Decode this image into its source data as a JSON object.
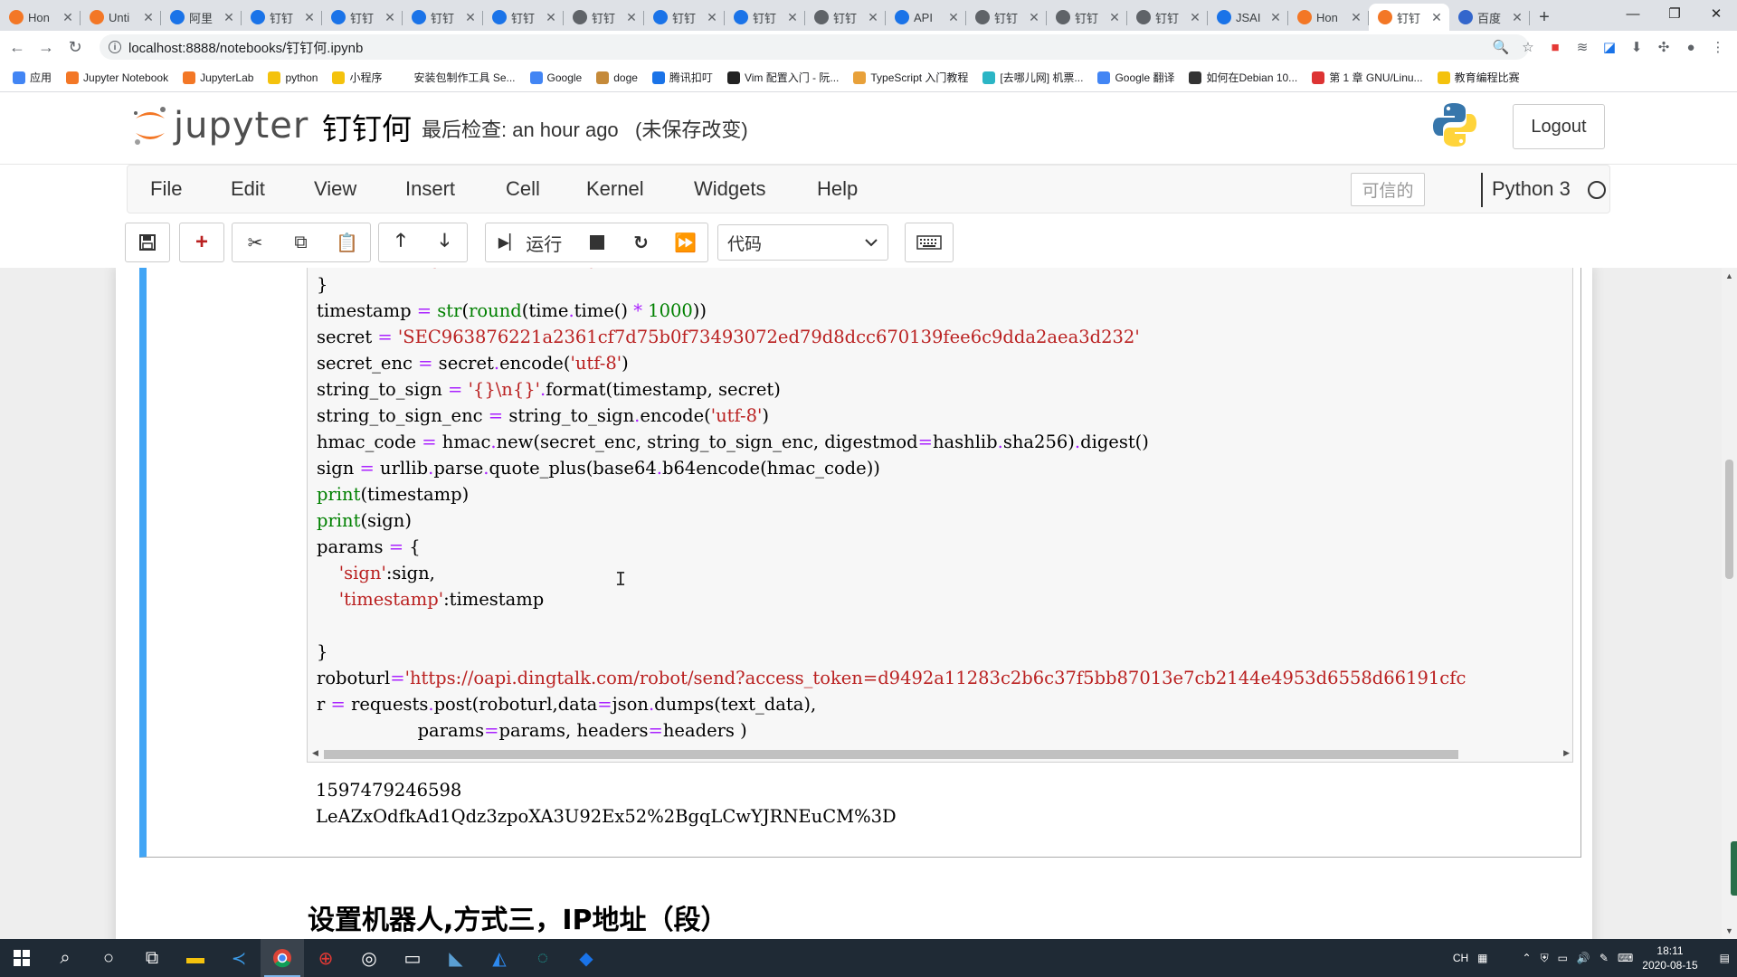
{
  "browser": {
    "tabs": [
      {
        "title": "Hon",
        "color": "#f37726"
      },
      {
        "title": "Unti",
        "color": "#f37726"
      },
      {
        "title": "阿里",
        "color": "#1a73e8"
      },
      {
        "title": "钉钉",
        "color": "#1a73e8"
      },
      {
        "title": "钉钉",
        "color": "#1a73e8"
      },
      {
        "title": "钉钉",
        "color": "#1a73e8"
      },
      {
        "title": "钉钉",
        "color": "#1a73e8"
      },
      {
        "title": "钉钉",
        "color": "#5f6368"
      },
      {
        "title": "钉钉",
        "color": "#1a73e8"
      },
      {
        "title": "钉钉",
        "color": "#1a73e8"
      },
      {
        "title": "钉钉",
        "color": "#5f6368"
      },
      {
        "title": "API",
        "color": "#1a73e8"
      },
      {
        "title": "钉钉",
        "color": "#5f6368"
      },
      {
        "title": "钉钉",
        "color": "#5f6368"
      },
      {
        "title": "钉钉",
        "color": "#5f6368"
      },
      {
        "title": "JSAI",
        "color": "#1a73e8"
      },
      {
        "title": "Hon",
        "color": "#f37726"
      },
      {
        "title": "钉钉",
        "color": "#f37726",
        "active": true
      },
      {
        "title": "百度",
        "color": "#3366cc"
      }
    ],
    "url": "localhost:8888/notebooks/钉钉何.ipynb",
    "bookmarks": [
      {
        "label": "应用",
        "color": "#4285f4"
      },
      {
        "label": "Jupyter Notebook",
        "color": "#f37726"
      },
      {
        "label": "JupyterLab",
        "color": "#f37726"
      },
      {
        "label": "python",
        "color": "#f4c20d"
      },
      {
        "label": "小程序",
        "color": "#f4c20d"
      },
      {
        "label": "安装包制作工具 Se...",
        "color": "#ffffff"
      },
      {
        "label": "Google",
        "color": "#4285f4"
      },
      {
        "label": "doge",
        "color": "#c58a3a"
      },
      {
        "label": "腾讯扣叮",
        "color": "#1a73e8"
      },
      {
        "label": "Vim 配置入门 - 阮...",
        "color": "#222222"
      },
      {
        "label": "TypeScript 入门教程",
        "color": "#e8a13a"
      },
      {
        "label": "[去哪儿网] 机票...",
        "color": "#2bb5c5"
      },
      {
        "label": "Google 翻译",
        "color": "#4285f4"
      },
      {
        "label": "如何在Debian 10...",
        "color": "#333333"
      },
      {
        "label": "第 1 章 GNU/Linu...",
        "color": "#d33"
      },
      {
        "label": "教育编程比赛",
        "color": "#f4c20d"
      }
    ]
  },
  "jupyter": {
    "logo_text": "jupyter",
    "notebook_name": "钉钉何",
    "checkpoint": "最后检查: an hour ago",
    "autosave": "(未保存改变)",
    "logout": "Logout",
    "menu": [
      "File",
      "Edit",
      "View",
      "Insert",
      "Cell",
      "Kernel",
      "Widgets",
      "Help"
    ],
    "trusted": "可信的",
    "kernel": "Python 3",
    "run_label": "运行",
    "cell_type": "代码"
  },
  "cell": {
    "code_html_note": "lines rendered with syntax spans",
    "lines": [
      [
        [
          "    ",
          "p"
        ],
        [
          "'Content-Type'",
          "s"
        ],
        [
          ": ",
          "p"
        ],
        [
          "'application/json'",
          "s"
        ],
        [
          ",",
          "p"
        ]
      ],
      [
        [
          "}",
          "p"
        ]
      ],
      [
        [
          "timestamp ",
          "p"
        ],
        [
          "=",
          "o"
        ],
        [
          " ",
          "p"
        ],
        [
          "str",
          "b"
        ],
        [
          "(",
          "p"
        ],
        [
          "round",
          "b"
        ],
        [
          "(time",
          "p"
        ],
        [
          ".",
          "o"
        ],
        [
          "time() ",
          "p"
        ],
        [
          "*",
          "o"
        ],
        [
          " ",
          "p"
        ],
        [
          "1000",
          "b"
        ],
        [
          "))",
          "p"
        ]
      ],
      [
        [
          "secret ",
          "p"
        ],
        [
          "=",
          "o"
        ],
        [
          " ",
          "p"
        ],
        [
          "'SEC963876221a2361cf7d75b0f73493072ed79d8dcc670139fee6c9dda2aea3d232'",
          "s"
        ]
      ],
      [
        [
          "secret_enc ",
          "p"
        ],
        [
          "=",
          "o"
        ],
        [
          " secret",
          "p"
        ],
        [
          ".",
          "o"
        ],
        [
          "encode(",
          "p"
        ],
        [
          "'utf-8'",
          "s"
        ],
        [
          ")",
          "p"
        ]
      ],
      [
        [
          "string_to_sign ",
          "p"
        ],
        [
          "=",
          "o"
        ],
        [
          " ",
          "p"
        ],
        [
          "'{}\\n{}'",
          "s"
        ],
        [
          ".",
          "o"
        ],
        [
          "format(timestamp, secret)",
          "p"
        ]
      ],
      [
        [
          "string_to_sign_enc ",
          "p"
        ],
        [
          "=",
          "o"
        ],
        [
          " string_to_sign",
          "p"
        ],
        [
          ".",
          "o"
        ],
        [
          "encode(",
          "p"
        ],
        [
          "'utf-8'",
          "s"
        ],
        [
          ")",
          "p"
        ]
      ],
      [
        [
          "hmac_code ",
          "p"
        ],
        [
          "=",
          "o"
        ],
        [
          " hmac",
          "p"
        ],
        [
          ".",
          "o"
        ],
        [
          "new(secret_enc, string_to_sign_enc, digestmod",
          "p"
        ],
        [
          "=",
          "o"
        ],
        [
          "hashlib",
          "p"
        ],
        [
          ".",
          "o"
        ],
        [
          "sha256)",
          "p"
        ],
        [
          ".",
          "o"
        ],
        [
          "digest()",
          "p"
        ]
      ],
      [
        [
          "sign ",
          "p"
        ],
        [
          "=",
          "o"
        ],
        [
          " urllib",
          "p"
        ],
        [
          ".",
          "o"
        ],
        [
          "parse",
          "p"
        ],
        [
          ".",
          "o"
        ],
        [
          "quote_plus(base64",
          "p"
        ],
        [
          ".",
          "o"
        ],
        [
          "b64encode(hmac_code))",
          "p"
        ]
      ],
      [
        [
          "print",
          "b"
        ],
        [
          "(timestamp)",
          "p"
        ]
      ],
      [
        [
          "print",
          "b"
        ],
        [
          "(sign)",
          "p"
        ]
      ],
      [
        [
          "params ",
          "p"
        ],
        [
          "=",
          "o"
        ],
        [
          " {",
          "p"
        ]
      ],
      [
        [
          "    ",
          "p"
        ],
        [
          "'sign'",
          "s"
        ],
        [
          ":sign,",
          "p"
        ]
      ],
      [
        [
          "    ",
          "p"
        ],
        [
          "'timestamp'",
          "s"
        ],
        [
          ":timestamp",
          "p"
        ]
      ],
      [
        [
          "",
          "p"
        ]
      ],
      [
        [
          "}",
          "p"
        ]
      ],
      [
        [
          "roboturl",
          "p"
        ],
        [
          "=",
          "o"
        ],
        [
          "'https://oapi.dingtalk.com/robot/send?access_token=d9492a11283c2b6c37f5bb87013e7cb2144e4953d6558d66191cfc",
          "s"
        ]
      ],
      [
        [
          "r ",
          "p"
        ],
        [
          "=",
          "o"
        ],
        [
          " requests",
          "p"
        ],
        [
          ".",
          "o"
        ],
        [
          "post(roboturl,data",
          "p"
        ],
        [
          "=",
          "o"
        ],
        [
          "json",
          "p"
        ],
        [
          ".",
          "o"
        ],
        [
          "dumps(text_data),",
          "p"
        ]
      ],
      [
        [
          "                  params",
          "p"
        ],
        [
          "=",
          "o"
        ],
        [
          "params, headers",
          "p"
        ],
        [
          "=",
          "o"
        ],
        [
          "headers )",
          "p"
        ]
      ]
    ],
    "output": [
      "1597479246598",
      "LeAZxOdfkAd1Qdz3zpoXA3U92Ex52%2BgqLCwYJRNEuCM%3D"
    ]
  },
  "markdown_heading": "设置机器人,方式三，IP地址（段）",
  "taskbar": {
    "time": "18:11",
    "date": "2020-08-15",
    "ime": "CH"
  }
}
